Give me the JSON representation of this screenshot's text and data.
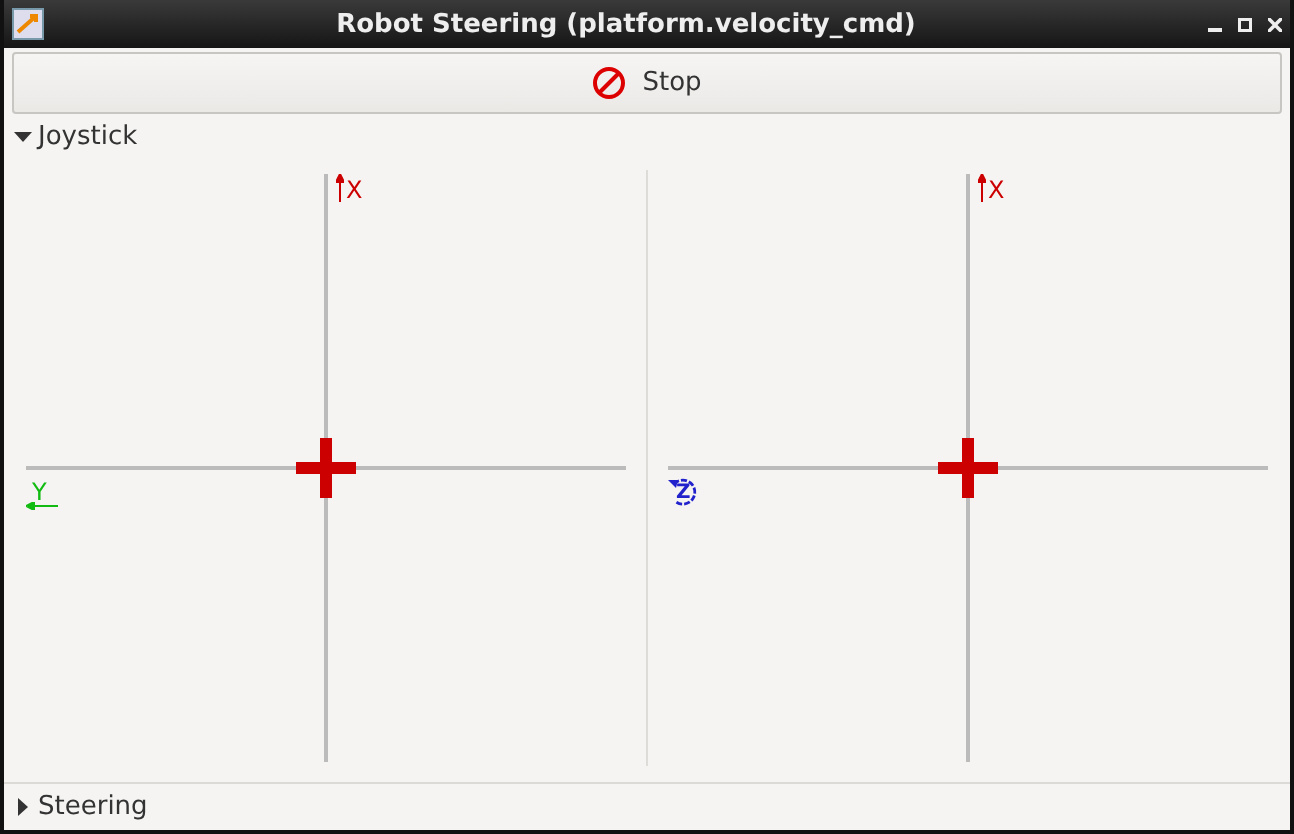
{
  "window": {
    "title": "Robot Steering (platform.velocity_cmd)"
  },
  "stop_button": {
    "label": "Stop"
  },
  "joystick_section": {
    "label": "Joystick",
    "expanded": true
  },
  "joysticks": [
    {
      "vertical_label": "X",
      "horizontal_axis": {
        "label": "Y",
        "kind": "linear"
      }
    },
    {
      "vertical_label": "X",
      "horizontal_axis": {
        "label": "Z",
        "kind": "rotation"
      }
    }
  ],
  "steering_section": {
    "label": "Steering",
    "expanded": false
  }
}
